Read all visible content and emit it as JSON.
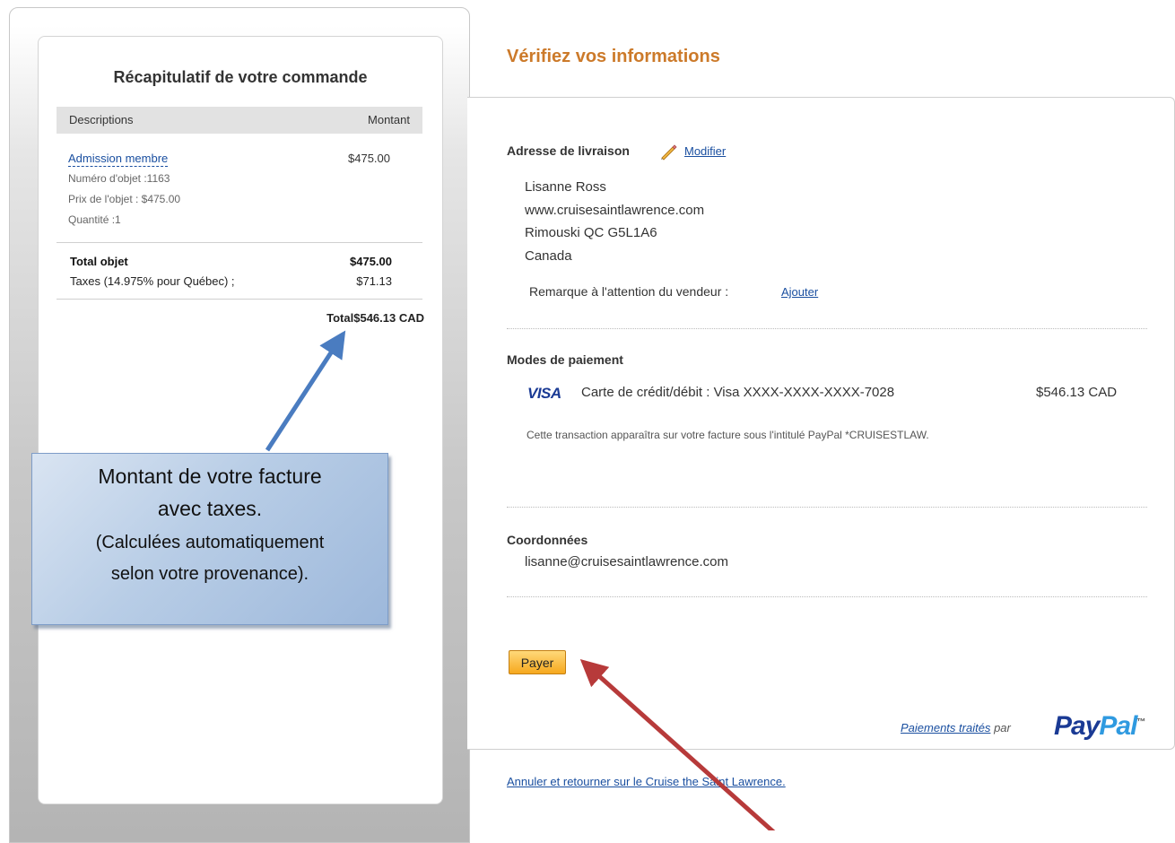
{
  "summary": {
    "title": "Récapitulatif de votre commande",
    "col_desc": "Descriptions",
    "col_amount": "Montant",
    "item_name": "Admission membre",
    "item_price": "$475.00",
    "item_number": "Numéro d'objet :1163",
    "item_unit_price": "Prix de l'objet : $475.00",
    "item_qty": "Quantité :1",
    "total_label": "Total objet",
    "total_value": "$475.00",
    "tax_label": "Taxes (14.975% pour Québec) ;",
    "tax_value": "$71.13",
    "grand_total": "Total$546.13 CAD"
  },
  "callout": {
    "line1": "Montant de votre facture",
    "line2": "avec  taxes.",
    "line3": "(Calculées automatiquement",
    "line4": "selon votre provenance)."
  },
  "main": {
    "title": "Vérifiez vos informations",
    "shipping_heading": "Adresse de livraison",
    "modify_link": "Modifier",
    "address": [
      "Lisanne Ross",
      "www.cruisesaintlawrence.com",
      "Rimouski QC  G5L1A6",
      "Canada"
    ],
    "seller_note_label": "Remarque à l'attention du vendeur :",
    "seller_note_link": "Ajouter",
    "payment_heading": "Modes de paiement",
    "card_brand": "VISA",
    "card_text": "Carte de crédit/débit : Visa XXXX-XXXX-XXXX-7028",
    "card_amount": "$546.13 CAD",
    "transaction_note": "Cette transaction apparaîtra sur votre facture sous l'intitulé PayPal *CRUISESTLAW.",
    "contact_heading": "Coordonnées",
    "contact_email": "lisanne@cruisesaintlawrence.com",
    "pay_button": "Payer",
    "processed_link": "Paiements traités",
    "processed_by": "par",
    "paypal_logo_a": "Pay",
    "paypal_logo_b": "Pal",
    "paypal_tm": "™",
    "cancel_link": "Annuler et retourner sur le Cruise the Saint Lawrence."
  },
  "colors": {
    "title_orange": "#cc7a2a",
    "link_blue": "#1a4fa0",
    "arrow_blue": "#4a7cc0",
    "arrow_red": "#b73a3a",
    "pay_button": "#f6a81e"
  }
}
